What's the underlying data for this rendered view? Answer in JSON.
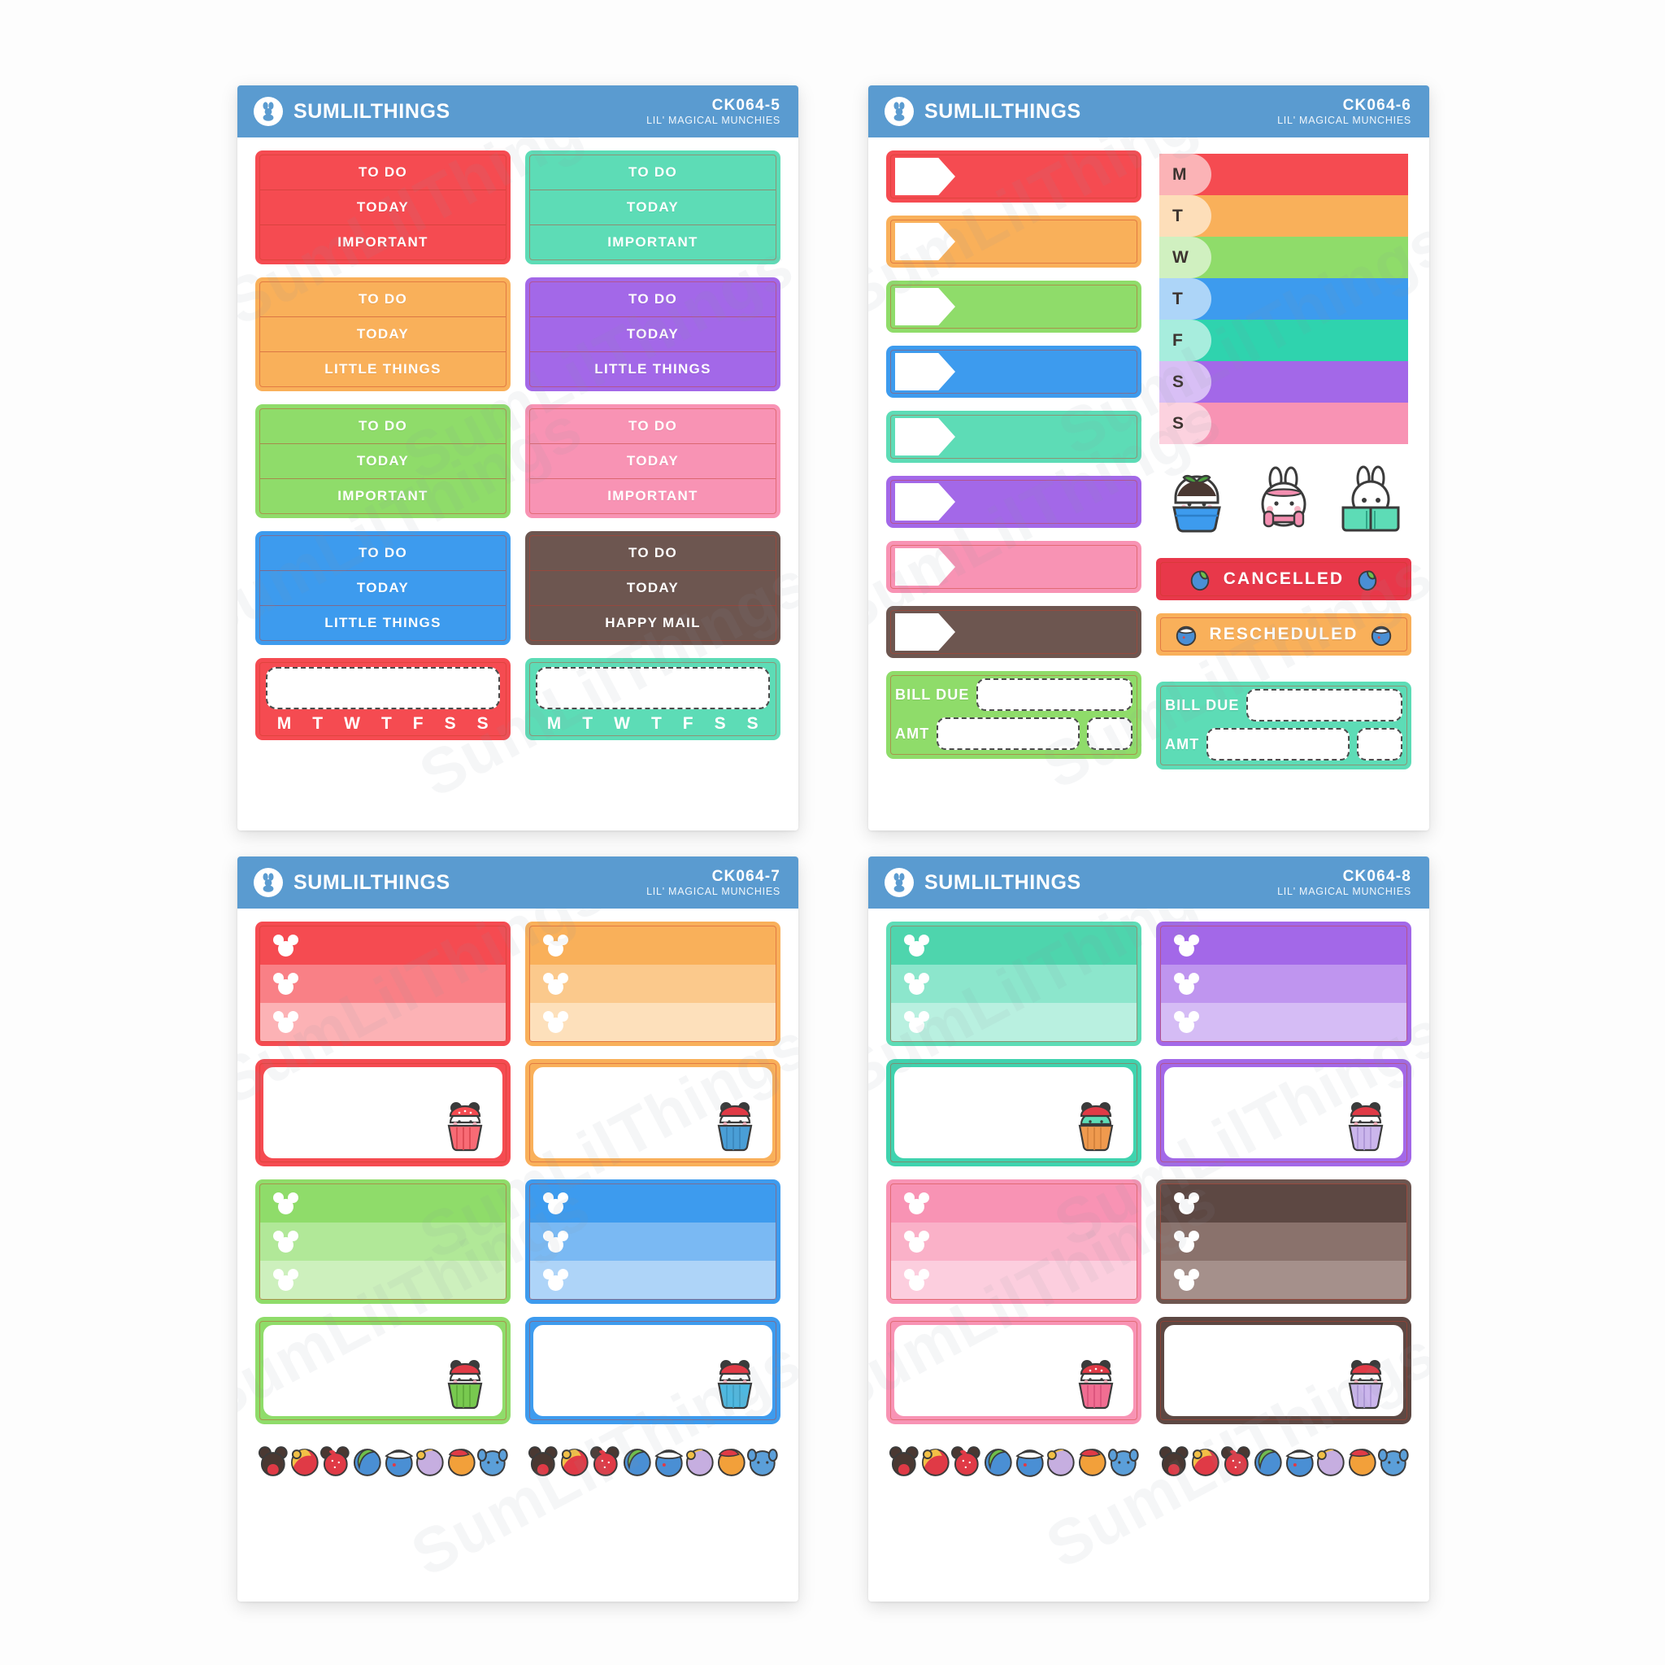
{
  "meta": {
    "brand": "SUMLILTHINGS",
    "collection": "LIL' MAGICAL MUNCHIES",
    "background": "#fdfdfd",
    "header_color": "#5a9bd0",
    "watermark_text": "SumLilThings"
  },
  "palette": {
    "red": "#f54b51",
    "orange": "#f9b05a",
    "green": "#8fdc6a",
    "blue": "#3d9bee",
    "teal": "#5ddcb6",
    "purple": "#a368e8",
    "pink": "#f893b4",
    "brown": "#6d5650"
  },
  "sheets": [
    {
      "id": "sheet-1",
      "code": "CK064-5",
      "subtitle": "LIL' MAGICAL MUNCHIES",
      "todo_blocks": [
        {
          "color": "#f54b51",
          "rows": [
            "TO DO",
            "TODAY",
            "IMPORTANT"
          ]
        },
        {
          "color": "#5ddcb6",
          "rows": [
            "TO DO",
            "TODAY",
            "IMPORTANT"
          ]
        },
        {
          "color": "#f9b05a",
          "rows": [
            "TO DO",
            "TODAY",
            "LITTLE THINGS"
          ]
        },
        {
          "color": "#a368e8",
          "rows": [
            "TO DO",
            "TODAY",
            "LITTLE THINGS"
          ]
        },
        {
          "color": "#8fdc6a",
          "rows": [
            "TO DO",
            "TODAY",
            "IMPORTANT"
          ]
        },
        {
          "color": "#f893b4",
          "rows": [
            "TO DO",
            "TODAY",
            "IMPORTANT"
          ]
        },
        {
          "color": "#3d9bee",
          "rows": [
            "TO DO",
            "TODAY",
            "LITTLE THINGS"
          ]
        },
        {
          "color": "#6d5650",
          "rows": [
            "TO DO",
            "TODAY",
            "HAPPY MAIL"
          ]
        }
      ],
      "week_boxes": [
        {
          "color": "#f54b51",
          "days": [
            "M",
            "T",
            "W",
            "T",
            "F",
            "S",
            "S"
          ]
        },
        {
          "color": "#5ddcb6",
          "days": [
            "M",
            "T",
            "W",
            "T",
            "F",
            "S",
            "S"
          ]
        }
      ]
    },
    {
      "id": "sheet-2",
      "code": "CK064-6",
      "subtitle": "LIL' MAGICAL MUNCHIES",
      "flag_strips": [
        {
          "color": "#f54b51"
        },
        {
          "color": "#f9b05a"
        },
        {
          "color": "#8fdc6a"
        },
        {
          "color": "#3d9bee"
        },
        {
          "color": "#5ddcb6"
        },
        {
          "color": "#a368e8"
        },
        {
          "color": "#f893b4"
        },
        {
          "color": "#6d5650"
        }
      ],
      "day_strips": [
        {
          "label": "M",
          "color": "#f54b51"
        },
        {
          "label": "T",
          "color": "#f9b05a"
        },
        {
          "label": "W",
          "color": "#8fdc6a"
        },
        {
          "label": "T",
          "color": "#3d9bee"
        },
        {
          "label": "F",
          "color": "#2fd3ae"
        },
        {
          "label": "S",
          "color": "#a368e8"
        },
        {
          "label": "S",
          "color": "#f893b4"
        }
      ],
      "characters": [
        {
          "name": "bunny-in-blue-cupcake-sticker"
        },
        {
          "name": "bunny-with-pink-dumbbell-sticker"
        },
        {
          "name": "bunny-reading-teal-book-sticker"
        }
      ],
      "banners": [
        {
          "label": "CANCELLED",
          "color": "#e8384a",
          "icon": "blue-green-fruit-icon"
        },
        {
          "label": "RESCHEDULED",
          "color": "#f9b05a",
          "icon": "blue-ball-fruit-icon"
        }
      ],
      "bill_boxes": [
        {
          "color": "#8fdc6a",
          "rows": [
            "BILL DUE",
            "AMT"
          ]
        },
        {
          "color": "#5ddcb6",
          "rows": [
            "BILL DUE",
            "AMT"
          ]
        }
      ]
    },
    {
      "id": "sheet-3",
      "code": "CK064-7",
      "subtitle": "LIL' MAGICAL MUNCHIES",
      "band_blocks": [
        {
          "color": "#f54b51",
          "bands": 3,
          "icon": "mickey-head-icon"
        },
        {
          "color": "#f9b05a",
          "bands": 3,
          "icon": "mickey-head-icon"
        },
        {
          "color": "#8fdc6a",
          "bands": 3,
          "icon": "mickey-head-icon"
        },
        {
          "color": "#3d9bee",
          "bands": 3,
          "icon": "mickey-head-icon"
        }
      ],
      "note_boxes": [
        {
          "color": "#f54b51",
          "cupcake": "minnie-red-cupcake-icon"
        },
        {
          "color": "#f9b05a",
          "cupcake": "mickey-orange-cupcake-icon"
        },
        {
          "color": "#8fdc6a",
          "cupcake": "mickey-green-cupcake-icon"
        },
        {
          "color": "#3d9bee",
          "cupcake": "mickey-blue-cupcake-icon"
        }
      ],
      "fruit_strip": {
        "count": 8,
        "items": [
          "mickey-chocolate-apple-icon",
          "pooh-yellow-apple-icon",
          "minnie-strawberry-icon",
          "peter-pan-green-plum-icon",
          "donald-blueberry-icon",
          "daisy-purple-plum-icon",
          "snow-white-apple-icon",
          "stitch-blue-berry-icon"
        ]
      }
    },
    {
      "id": "sheet-4",
      "code": "CK064-8",
      "subtitle": "LIL' MAGICAL MUNCHIES",
      "band_blocks": [
        {
          "color": "#5ddcb6",
          "bands": 3,
          "icon": "mickey-head-icon"
        },
        {
          "color": "#a368e8",
          "bands": 3,
          "icon": "mickey-head-icon"
        },
        {
          "color": "#f893b4",
          "bands": 3,
          "icon": "mickey-head-icon"
        },
        {
          "color": "#6d5650",
          "bands": 3,
          "icon": "mickey-head-icon"
        }
      ],
      "note_boxes": [
        {
          "color": "#5ddcb6",
          "cupcake": "mickey-teal-cupcake-icon"
        },
        {
          "color": "#a368e8",
          "cupcake": "mickey-purple-cupcake-icon"
        },
        {
          "color": "#f893b4",
          "cupcake": "minnie-pink-cupcake-icon"
        },
        {
          "color": "#6d5650",
          "cupcake": "mickey-brown-cupcake-icon"
        }
      ],
      "fruit_strip": {
        "count": 8,
        "items": [
          "mickey-chocolate-apple-icon",
          "pooh-yellow-apple-icon",
          "minnie-strawberry-icon",
          "peter-pan-green-plum-icon",
          "donald-blueberry-icon",
          "daisy-purple-plum-icon",
          "snow-white-apple-icon",
          "stitch-blue-berry-icon"
        ]
      }
    }
  ]
}
